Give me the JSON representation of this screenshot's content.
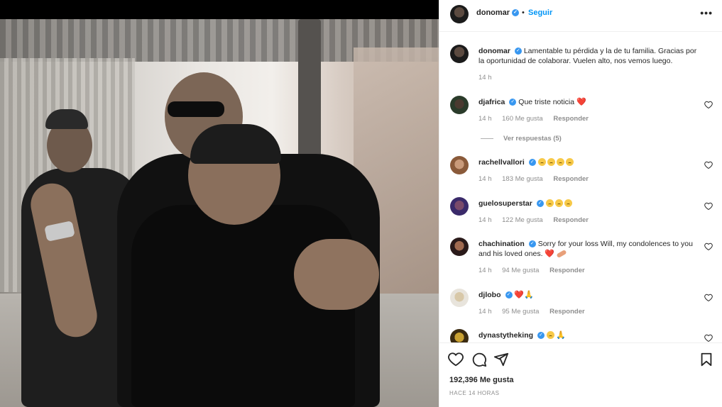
{
  "header": {
    "username": "donomar",
    "dot": "•",
    "follow_label": "Seguir",
    "more": "•••"
  },
  "caption": {
    "username": "donomar",
    "text": "Lamentable tu pérdida y la de tu familia. Gracias por la oportunidad de colaborar. Vuelen alto, nos vemos luego.",
    "time": "14 h"
  },
  "comments": [
    {
      "username": "djafrica",
      "text": "Que triste noticia",
      "emoji": "heart-broken",
      "time": "14 h",
      "likes": "160 Me gusta",
      "reply": "Responder",
      "view_replies": "Ver respuestas (5)"
    },
    {
      "username": "rachellvallori",
      "text": "",
      "emoji": "sad-x4",
      "time": "14 h",
      "likes": "183 Me gusta",
      "reply": "Responder"
    },
    {
      "username": "guelosuperstar",
      "text": "",
      "emoji": "sad-x3",
      "time": "14 h",
      "likes": "122 Me gusta",
      "reply": "Responder"
    },
    {
      "username": "chachination",
      "text": "Sorry for your loss Will, my condolences to you and his loved ones.",
      "emoji": "heart-bandage",
      "time": "14 h",
      "likes": "94 Me gusta",
      "reply": "Responder"
    },
    {
      "username": "djlobo",
      "text": "",
      "emoji": "heart-pray",
      "time": "14 h",
      "likes": "95 Me gusta",
      "reply": "Responder"
    },
    {
      "username": "dynastytheking",
      "text": "",
      "emoji": "sad-pray",
      "time": "",
      "likes": "",
      "reply": ""
    }
  ],
  "footer": {
    "likes": "192,396 Me gusta",
    "time_ago": "HACE 14 HORAS"
  },
  "colors": {
    "accent": "#0095f6",
    "verified": "#3897f0",
    "muted": "#8e8e8e",
    "text": "#262626"
  }
}
